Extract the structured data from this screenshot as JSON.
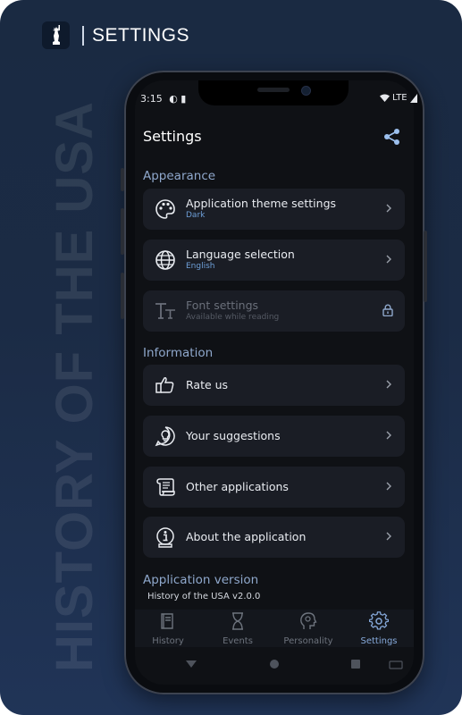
{
  "header": {
    "title": "SETTINGS"
  },
  "vertical_title": "HISTORY OF THE USA",
  "status_bar": {
    "time": "3:15",
    "network": "LTE"
  },
  "app": {
    "title": "Settings"
  },
  "sections": {
    "appearance": "Appearance",
    "information": "Information",
    "version": "Application version"
  },
  "appearance_items": [
    {
      "label": "Application theme settings",
      "sub": "Dark",
      "icon": "palette-icon"
    },
    {
      "label": "Language selection",
      "sub": "English",
      "icon": "globe-icon"
    },
    {
      "label": "Font settings",
      "sub": "Available while reading",
      "icon": "font-icon"
    }
  ],
  "information_items": [
    {
      "label": "Rate us",
      "icon": "rate-icon"
    },
    {
      "label": "Your suggestions",
      "icon": "suggestion-icon"
    },
    {
      "label": "Other applications",
      "icon": "scroll-icon"
    },
    {
      "label": "About the application",
      "icon": "info-icon"
    }
  ],
  "version_text": "History of the USA v2.0.0",
  "bottom_nav": [
    {
      "label": "History",
      "icon": "book-icon"
    },
    {
      "label": "Events",
      "icon": "hourglass-icon"
    },
    {
      "label": "Personality",
      "icon": "head-icon"
    },
    {
      "label": "Settings",
      "icon": "gear-icon",
      "active": true
    }
  ],
  "colors": {
    "accent": "#86a9da",
    "section": "#8fa8cc",
    "card": "#1a1d25",
    "background": "#1b2b45"
  }
}
